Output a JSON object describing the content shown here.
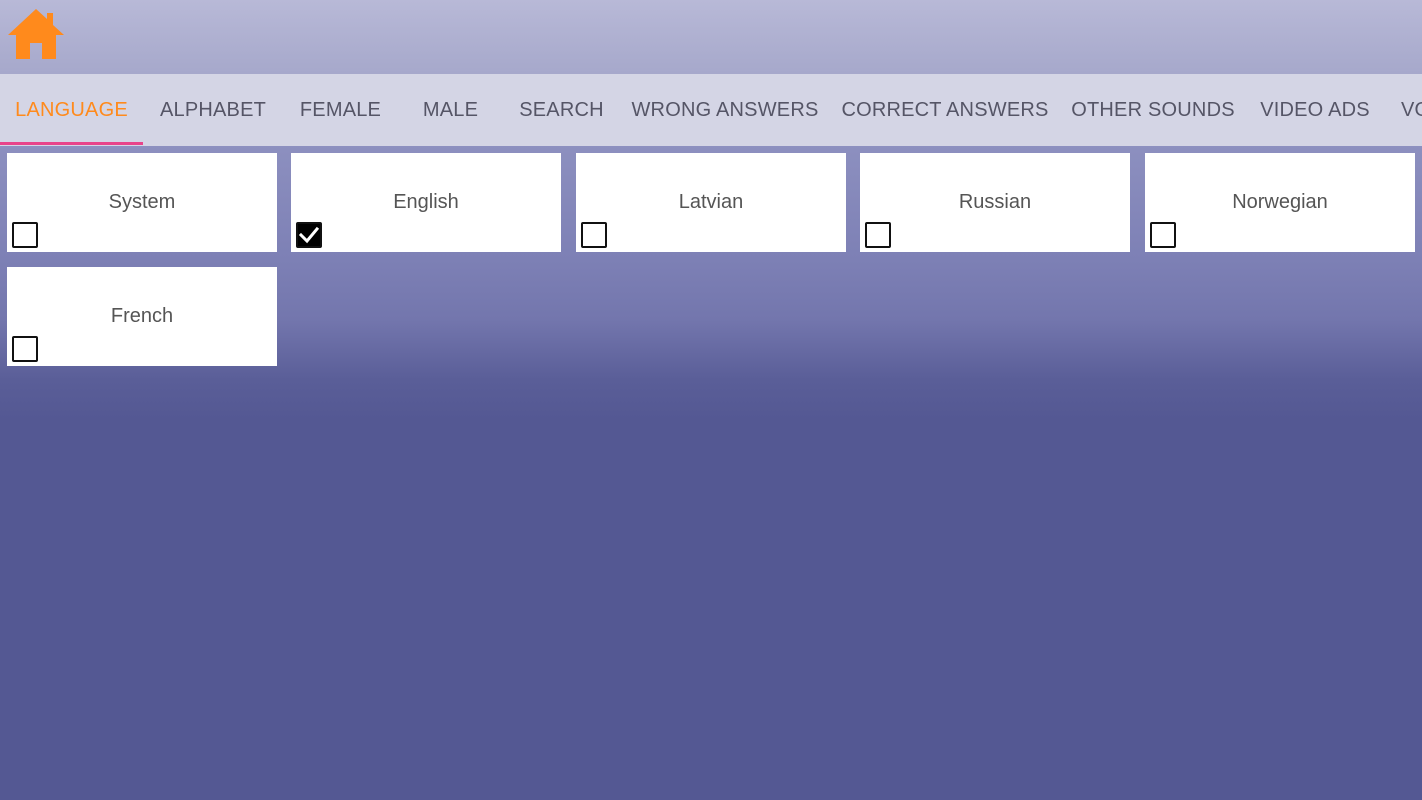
{
  "header": {
    "home_icon": "home-icon",
    "home_color": "#ff8a1c"
  },
  "tabs": [
    {
      "label": "LANGUAGE",
      "active": true
    },
    {
      "label": "ALPHABET",
      "active": false
    },
    {
      "label": "FEMALE",
      "active": false
    },
    {
      "label": "MALE",
      "active": false
    },
    {
      "label": "SEARCH",
      "active": false
    },
    {
      "label": "WRONG ANSWERS",
      "active": false
    },
    {
      "label": "CORRECT ANSWERS",
      "active": false
    },
    {
      "label": "OTHER SOUNDS",
      "active": false
    },
    {
      "label": "VIDEO ADS",
      "active": false
    },
    {
      "label": "VO",
      "active": false
    }
  ],
  "colors": {
    "active_tab": "#ff8a1c",
    "indicator": "#e8448a",
    "background": "#545893"
  },
  "languages": [
    {
      "label": "System",
      "checked": false
    },
    {
      "label": "English",
      "checked": true
    },
    {
      "label": "Latvian",
      "checked": false
    },
    {
      "label": "Russian",
      "checked": false
    },
    {
      "label": "Norwegian",
      "checked": false
    },
    {
      "label": "French",
      "checked": false
    }
  ]
}
